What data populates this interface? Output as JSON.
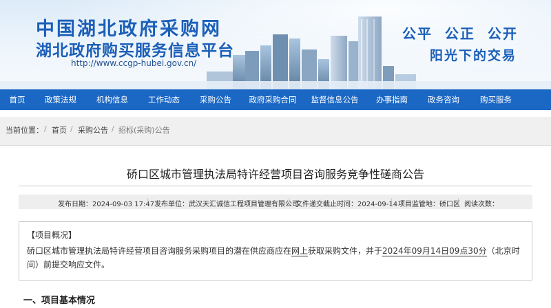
{
  "header": {
    "title_line1": "中国湖北政府采购网",
    "title_line2": "湖北政府购买服务信息平台",
    "url": "http://www.ccgp-hubei.gov.cn/",
    "slogan_line1": "公平  公正  公开",
    "slogan_line2": "阳光下的交易"
  },
  "nav": {
    "items": [
      {
        "label": "首页"
      },
      {
        "label": "政策法规"
      },
      {
        "label": "机构信息"
      },
      {
        "label": "工作动态"
      },
      {
        "label": "采购公告"
      },
      {
        "label": "政府采购合同"
      },
      {
        "label": "监督信息公告"
      },
      {
        "label": "办事指南"
      },
      {
        "label": "政务咨询"
      },
      {
        "label": "购买服务"
      }
    ]
  },
  "breadcrumb": {
    "prefix": "当前位置：",
    "items": [
      "首页",
      "采购公告",
      "招标(采购)公告"
    ]
  },
  "article": {
    "title": "硚口区城市管理执法局特许经营项目咨询服务竞争性磋商公告",
    "meta": {
      "publish_date": "发布日期：2024-09-03 17:47",
      "publisher": "发布单位：武汉天汇诚信工程项目管理有限公司",
      "deadline": "文件递交截止时间：2024-09-14",
      "supervision": "项目监管地：硚口区",
      "views": "阅读次数："
    },
    "overview": {
      "heading": "【项目概况】",
      "text_a": "硚口区城市管理执法局特许经营项目咨询服务采购项目的潜在供应商应在",
      "text_b": "网上",
      "text_c": "获取采购文件，并于",
      "text_d": "2024年09月14日09点30分",
      "text_e": "（北京时间）前提交响应文件。"
    },
    "section_heading": "一、项目基本情况"
  },
  "colors": {
    "nav_bg": "#1a67c4",
    "brand_blue": "#1b5fb8"
  }
}
